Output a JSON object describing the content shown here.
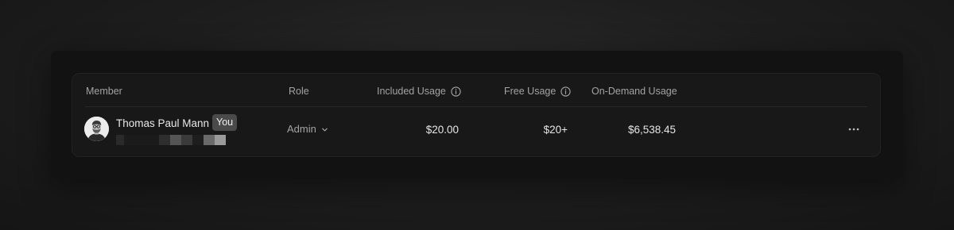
{
  "table": {
    "columns": {
      "member": "Member",
      "role": "Role",
      "included_usage": "Included Usage",
      "free_usage": "Free Usage",
      "on_demand_usage": "On-Demand Usage"
    },
    "rows": [
      {
        "name": "Thomas Paul Mann",
        "badge": "You",
        "role": "Admin",
        "included_usage": "$20.00",
        "free_usage": "$20+",
        "on_demand_usage": "$6,538.45"
      }
    ]
  },
  "icons": {
    "info": "info-icon",
    "role_chevron": "chevron-down-icon",
    "more": "more-horizontal-icon"
  },
  "colors": {
    "background": "#1a1a1a",
    "panel": "#121212",
    "card": "#181818",
    "badge": "#4a4a4a",
    "muted_text": "#a3a3a3",
    "primary_text": "#e6e6e6"
  }
}
